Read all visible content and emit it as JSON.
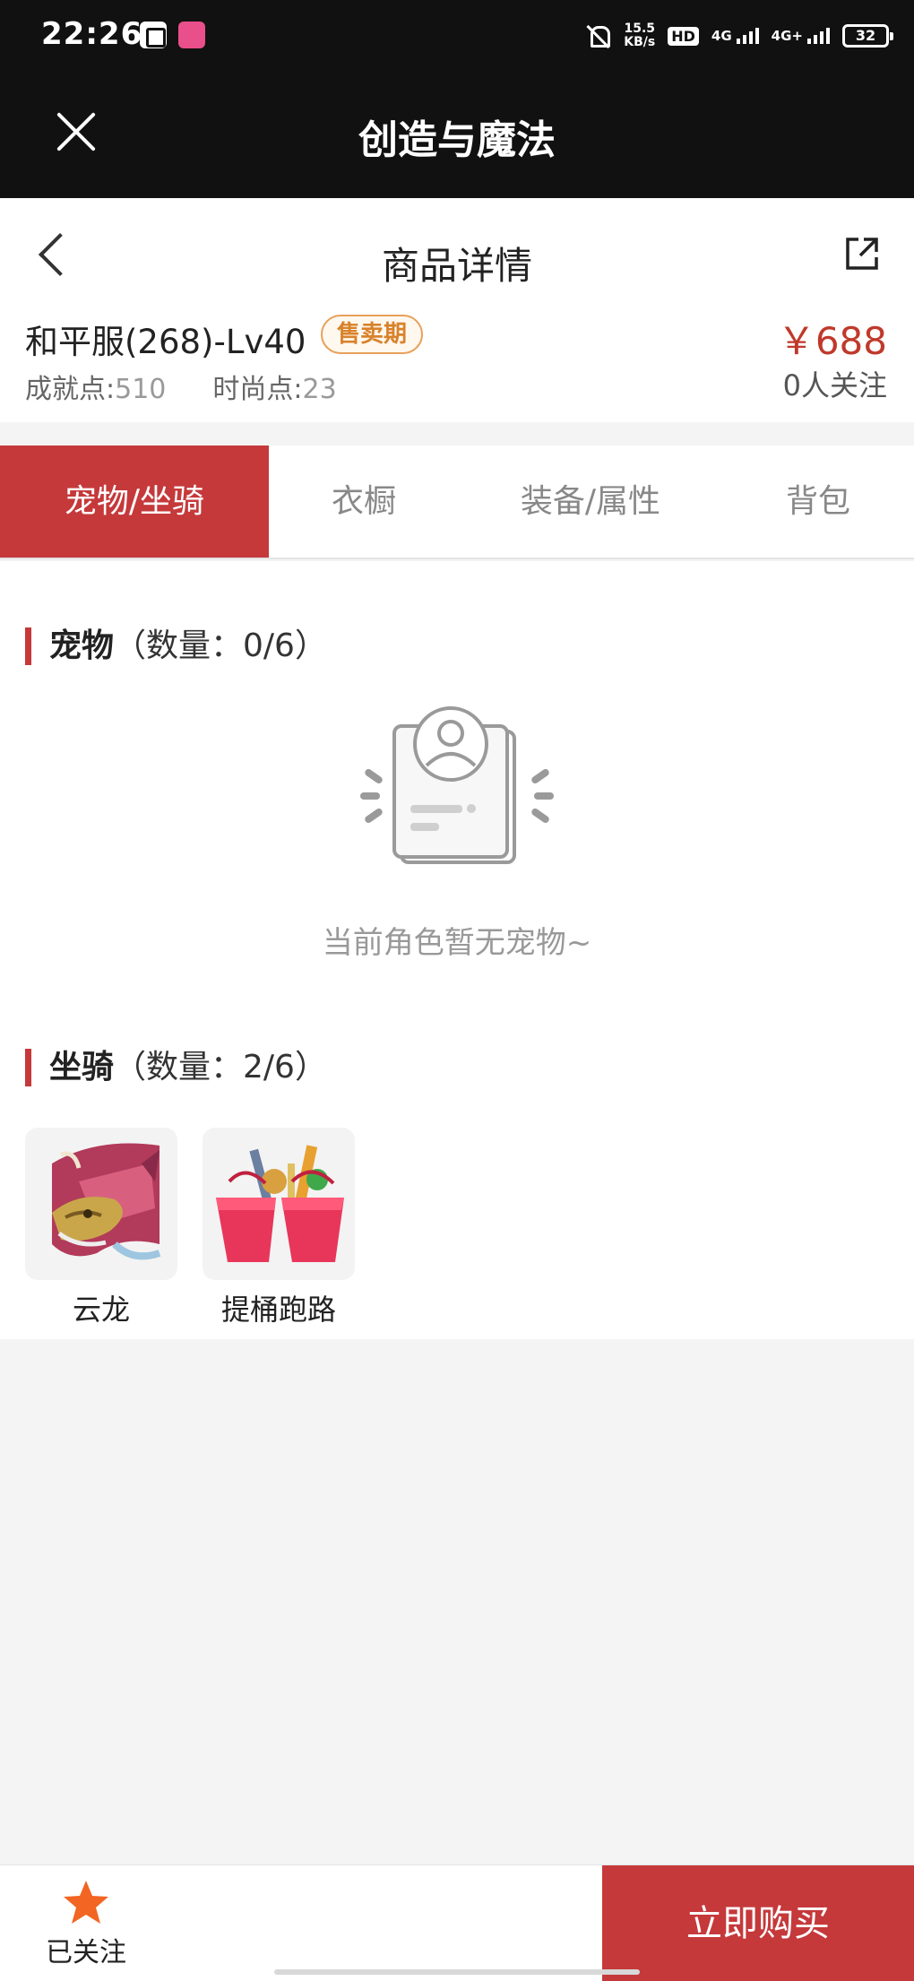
{
  "status_bar": {
    "time": "22:26",
    "net_speed_top": "15.5",
    "net_speed_unit": "KB/s",
    "hd": "HD",
    "sim1": "4G",
    "sim2": "4G+",
    "battery": "32"
  },
  "app": {
    "title": "创造与魔法"
  },
  "header": {
    "title": "商品详情"
  },
  "product": {
    "name": "和平服(268)-Lv40",
    "badge": "售卖期",
    "achievement_label": "成就点:",
    "achievement_value": "510",
    "fashion_label": "时尚点:",
    "fashion_value": "23",
    "price": "￥688",
    "followers": "0人关注"
  },
  "tabs": [
    {
      "label": "宠物/坐骑"
    },
    {
      "label": "衣橱"
    },
    {
      "label": "装备/属性"
    },
    {
      "label": "背包"
    }
  ],
  "pets": {
    "title": "宠物",
    "count": "（数量：0/6）",
    "empty_text": "当前角色暂无宠物~"
  },
  "mounts": {
    "title": "坐骑",
    "count": "（数量：2/6）",
    "items": [
      {
        "name": "云龙"
      },
      {
        "name": "提桶跑路"
      }
    ]
  },
  "bottom": {
    "follow_label": "已关注",
    "buy_label": "立即购买"
  },
  "colors": {
    "accent": "#c5393b",
    "price": "#c0392b",
    "badge": "#d9822b",
    "star": "#f26522"
  }
}
